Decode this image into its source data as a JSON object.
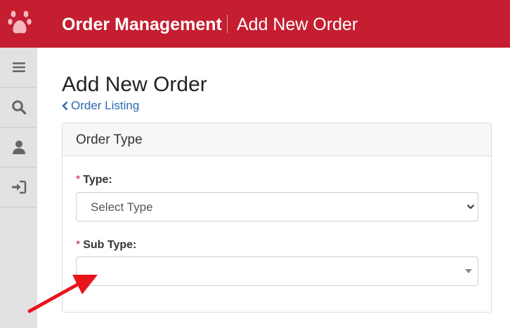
{
  "header": {
    "app_title": "Order Management",
    "page_crumb": "Add New Order",
    "brand_color": "#c41e30",
    "logo_icon": "paw-icon"
  },
  "sidebar": {
    "items": [
      {
        "icon": "menu-icon"
      },
      {
        "icon": "search-icon"
      },
      {
        "icon": "user-icon"
      },
      {
        "icon": "sign-out-icon"
      }
    ]
  },
  "main": {
    "heading": "Add New Order",
    "back_link": "Order Listing",
    "panel": {
      "title": "Order Type",
      "fields": [
        {
          "required_mark": "*",
          "label": "Type:",
          "value": "Select Type"
        },
        {
          "required_mark": "*",
          "label": "Sub Type:",
          "value": ""
        }
      ]
    }
  },
  "annotation": {
    "arrow_color": "#e8141c"
  }
}
